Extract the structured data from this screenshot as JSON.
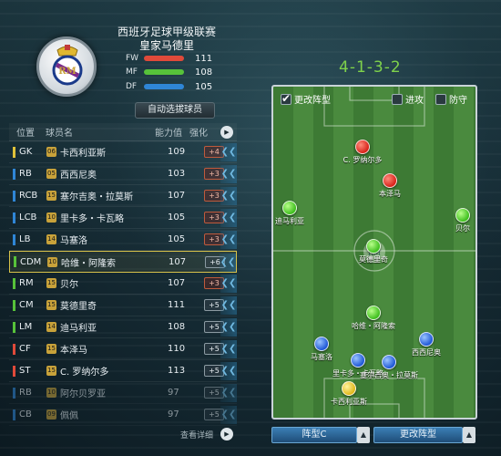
{
  "header": {
    "league": "西班牙足球甲级联赛",
    "team": "皇家马德里",
    "crest_icon": "real-madrid-crest-icon"
  },
  "stats": [
    {
      "label": "FW",
      "value": "111",
      "color": "#e04a3a"
    },
    {
      "label": "MF",
      "value": "108",
      "color": "#57c23a"
    },
    {
      "label": "DF",
      "value": "105",
      "color": "#2f86d6"
    }
  ],
  "auto_select_label": "自动选拔球员",
  "list_header": {
    "pos": "位置",
    "name": "球员名",
    "rating": "能力值",
    "improve": "强化",
    "play_icon": "play-icon"
  },
  "players": [
    {
      "pos": "GK",
      "num": "06",
      "name": "卡西利亚斯",
      "rating": "109",
      "improve": "+4",
      "pos_color": "#e0c23a"
    },
    {
      "pos": "RB",
      "num": "05",
      "name": "西西尼奥",
      "rating": "103",
      "improve": "+3",
      "pos_color": "#2f86d6"
    },
    {
      "pos": "RCB",
      "num": "15",
      "name": "塞尔吉奥・拉莫斯",
      "rating": "107",
      "improve": "+3",
      "pos_color": "#2f86d6"
    },
    {
      "pos": "LCB",
      "num": "10",
      "name": "里卡多・卡瓦略",
      "rating": "105",
      "improve": "+3",
      "pos_color": "#2f86d6"
    },
    {
      "pos": "LB",
      "num": "14",
      "name": "马塞洛",
      "rating": "105",
      "improve": "+3",
      "pos_color": "#2f86d6"
    },
    {
      "pos": "CDM",
      "num": "10",
      "name": "哈维・阿隆索",
      "rating": "107",
      "improve": "+6",
      "pos_color": "#57c23a"
    },
    {
      "pos": "RM",
      "num": "15",
      "name": "贝尔",
      "rating": "107",
      "improve": "+3",
      "pos_color": "#57c23a"
    },
    {
      "pos": "CM",
      "num": "15",
      "name": "莫德里奇",
      "rating": "111",
      "improve": "+5",
      "pos_color": "#57c23a"
    },
    {
      "pos": "LM",
      "num": "14",
      "name": "迪马利亚",
      "rating": "108",
      "improve": "+5",
      "pos_color": "#57c23a"
    },
    {
      "pos": "CF",
      "num": "15",
      "name": "本泽马",
      "rating": "110",
      "improve": "+5",
      "pos_color": "#e04a3a"
    },
    {
      "pos": "ST",
      "num": "15",
      "name": "C. 罗纳尔多",
      "rating": "113",
      "improve": "+5",
      "pos_color": "#e04a3a"
    },
    {
      "pos": "RB",
      "num": "10",
      "name": "阿尔贝罗亚",
      "rating": "97",
      "improve": "+5",
      "pos_color": "#2f86d6"
    },
    {
      "pos": "CB",
      "num": "09",
      "name": "佩佩",
      "rating": "97",
      "improve": "+5",
      "pos_color": "#2f86d6"
    }
  ],
  "view_detail": "查看详细",
  "formation": "4-1-3-2",
  "pitch_controls": {
    "change_formation": "更改阵型",
    "attack": "进攻",
    "defend": "防守"
  },
  "pitch_players": [
    {
      "name": "C. 罗纳尔多",
      "color": "red"
    },
    {
      "name": "本泽马",
      "color": "red"
    },
    {
      "name": "迪马利亚",
      "color": "green"
    },
    {
      "name": "贝尔",
      "color": "green"
    },
    {
      "name": "莫德里奇",
      "color": "green"
    },
    {
      "name": "哈维・阿隆索",
      "color": "green"
    },
    {
      "name": "马塞洛",
      "color": "blue"
    },
    {
      "name": "西西尼奥",
      "color": "blue"
    },
    {
      "name": "里卡多・卡瓦略",
      "color": "blue"
    },
    {
      "name": "塞尔吉奥・拉莫斯",
      "color": "blue"
    },
    {
      "name": "卡西利亚斯",
      "color": "yellow"
    }
  ],
  "bottom": {
    "formation_select": "阵型C",
    "change_formation": "更改阵型",
    "arrow_icon": "arrow-up-icon"
  }
}
